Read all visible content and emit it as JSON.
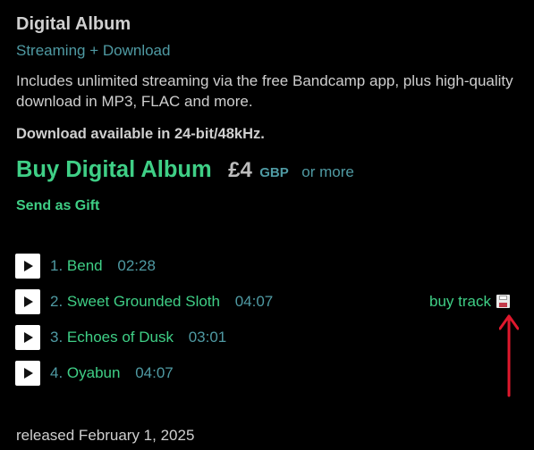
{
  "album": {
    "title": "Digital Album",
    "subtitle": "Streaming + Download",
    "description": "Includes unlimited streaming via the free Bandcamp app, plus high-quality download in MP3, FLAC and more.",
    "hi_res": "Download available in 24-bit/48kHz."
  },
  "buy": {
    "label": "Buy Digital Album",
    "price": "£4",
    "currency": "GBP",
    "or_more": "or more",
    "gift": "Send as Gift"
  },
  "tracks": [
    {
      "num": "1.",
      "title": "Bend",
      "time": "02:28"
    },
    {
      "num": "2.",
      "title": "Sweet Grounded Sloth",
      "time": "04:07",
      "buy_label": "buy track"
    },
    {
      "num": "3.",
      "title": "Echoes of Dusk",
      "time": "03:01"
    },
    {
      "num": "4.",
      "title": "Oyabun",
      "time": "04:07"
    }
  ],
  "released": "released February 1, 2025",
  "icons": {
    "play": "play-icon",
    "save": "floppy-disk-icon",
    "annotation": "red-arrow-up"
  },
  "colors": {
    "background": "#000000",
    "link_green": "#3fcf86",
    "teal": "#4f9aa3",
    "text": "#cfcfcf",
    "annotation_red": "#e0182d"
  }
}
